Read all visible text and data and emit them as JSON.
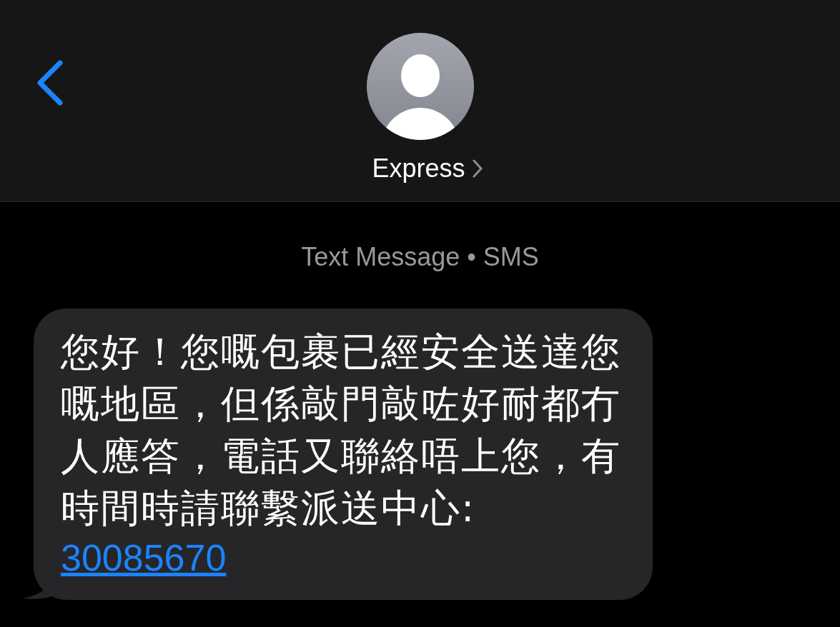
{
  "header": {
    "contact_name": "Express"
  },
  "service_label": "Text Message • SMS",
  "messages": [
    {
      "kind": "incoming",
      "text": "您好！您嘅包裹已經安全送達您嘅地區，但係敲門敲咗好耐都冇人應答，電話又聯絡唔上您，有時間時請聯繫派送中心:",
      "link": "30085670"
    }
  ]
}
